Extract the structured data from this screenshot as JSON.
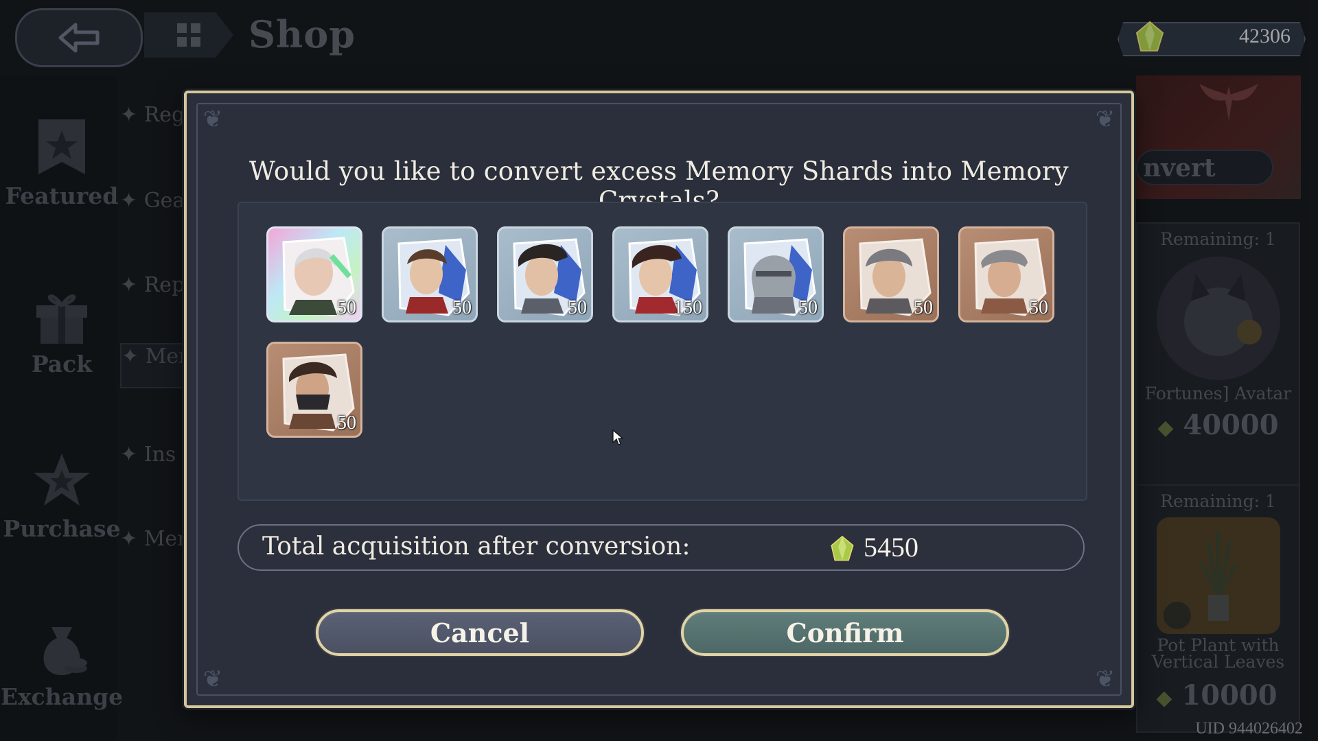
{
  "topbar": {
    "title": "Shop",
    "currency_value": "42306"
  },
  "sidebar": {
    "items": [
      {
        "label": "Featured",
        "icon": "star-banner-icon"
      },
      {
        "label": "Pack",
        "icon": "gift-icon"
      },
      {
        "label": "Purchase",
        "icon": "star-badge-icon"
      },
      {
        "label": "Exchange",
        "icon": "money-bag-icon"
      }
    ]
  },
  "subnav": {
    "items": [
      "Reg",
      "Gea",
      "Rep",
      "Mer",
      "Ins",
      "Mer"
    ]
  },
  "right_panel": {
    "convert_label": "nvert",
    "cards": [
      {
        "remaining": "Remaining: 1",
        "name": "Fortunes] Avatar",
        "price": "40000"
      },
      {
        "remaining": "Remaining: 1",
        "name": "Pot Plant with Vertical Leaves",
        "price": "10000"
      }
    ]
  },
  "uid": "UID 944026402",
  "dialog": {
    "question": "Would you like to convert excess Memory Shards into Memory Crystals?",
    "shards": [
      {
        "rarity": "rainbow",
        "count": "50"
      },
      {
        "rarity": "blue",
        "count": "50"
      },
      {
        "rarity": "blue",
        "count": "50"
      },
      {
        "rarity": "blue",
        "count": "150"
      },
      {
        "rarity": "blue",
        "count": "50"
      },
      {
        "rarity": "bronze",
        "count": "50"
      },
      {
        "rarity": "bronze",
        "count": "50"
      },
      {
        "rarity": "bronze",
        "count": "50"
      }
    ],
    "total_label": "Total acquisition after conversion:",
    "total_value": "5450",
    "cancel_label": "Cancel",
    "confirm_label": "Confirm"
  },
  "colors": {
    "dialog_border": "#d6c79a",
    "dialog_bg": "#2a2f3b",
    "cancel_bg": "#4f5668",
    "confirm_bg": "#557270"
  }
}
